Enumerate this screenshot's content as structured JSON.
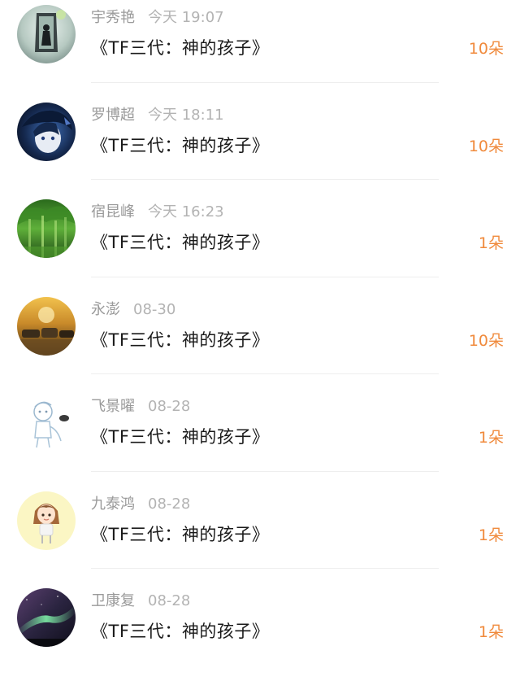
{
  "gifts": [
    {
      "name": "宇秀艳",
      "time": "今天 19:07",
      "title": "《TF三代：神的孩子》",
      "count": "10朵",
      "avatar": "lamp-silhouette"
    },
    {
      "name": "罗博超",
      "time": "今天 18:11",
      "title": "《TF三代：神的孩子》",
      "count": "10朵",
      "avatar": "anime-boy"
    },
    {
      "name": "宿昆峰",
      "time": "今天 16:23",
      "title": "《TF三代：神的孩子》",
      "count": "1朵",
      "avatar": "green-forest"
    },
    {
      "name": "永澎",
      "time": "08-30",
      "title": "《TF三代：神的孩子》",
      "count": "10朵",
      "avatar": "golden-cars"
    },
    {
      "name": "飞景曜",
      "time": "08-28",
      "title": "《TF三代：神的孩子》",
      "count": "1朵",
      "avatar": "sketch-character"
    },
    {
      "name": "九泰鸿",
      "time": "08-28",
      "title": "《TF三代：神的孩子》",
      "count": "1朵",
      "avatar": "cartoon-girl"
    },
    {
      "name": "卫康复",
      "time": "08-28",
      "title": "《TF三代：神的孩子》",
      "count": "1朵",
      "avatar": "aurora-sky"
    }
  ],
  "colors": {
    "accent": "#f08a3c",
    "name": "#9a9a9a",
    "title": "#1a1a1a"
  }
}
